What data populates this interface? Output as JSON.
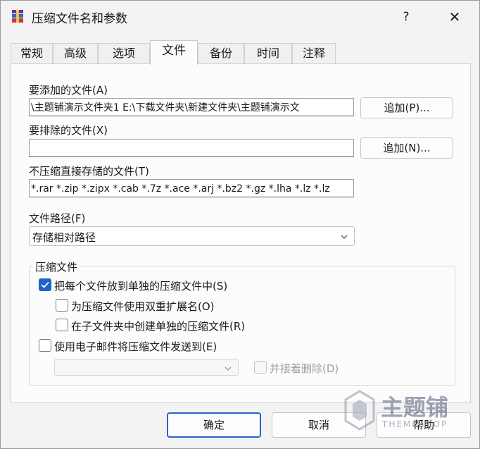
{
  "window": {
    "title": "压缩文件名和参数",
    "help_label": "?",
    "close_label": "✕"
  },
  "tabs": [
    "常规",
    "高级",
    "选项",
    "文件",
    "备份",
    "时间",
    "注释"
  ],
  "active_tab": "文件",
  "files": {
    "add_label": "要添加的文件",
    "add_hotkey": "(A)",
    "add_value": "\\主题铺演示文件夹1 E:\\下载文件夹\\新建文件夹\\主题铺演示文",
    "add_button": "追加(P)...",
    "exclude_label": "要排除的文件",
    "exclude_hotkey": "(X)",
    "exclude_value": "",
    "exclude_button": "追加(N)...",
    "store_label": "不压缩直接存储的文件",
    "store_hotkey": "(T)",
    "store_value": "*.rar *.zip *.zipx *.cab *.7z *.ace *.arj *.bz2 *.gz *.lha *.lz *.lz",
    "path_label": "文件路径",
    "path_hotkey": "(F)",
    "path_value": "存储相对路径"
  },
  "archive_group": {
    "title": "压缩文件",
    "each_file": "把每个文件放到单独的压缩文件中(S)",
    "each_file_checked": true,
    "double_ext": "为压缩文件使用双重扩展名(O)",
    "double_ext_checked": false,
    "subfolder": "在子文件夹中创建单独的压缩文件(R)",
    "subfolder_checked": false,
    "email": "使用电子邮件将压缩文件发送到(E)",
    "email_checked": false,
    "email_select_value": "",
    "delete_after": "并接着删除(D)",
    "delete_after_checked": false
  },
  "footer": {
    "ok": "确定",
    "cancel": "取消",
    "help": "帮助"
  },
  "watermark": {
    "text": "主题铺",
    "sub": "THEMESHOP"
  },
  "colors": {
    "accent": "#1f63c9",
    "ok_border": "#2b63c7"
  }
}
